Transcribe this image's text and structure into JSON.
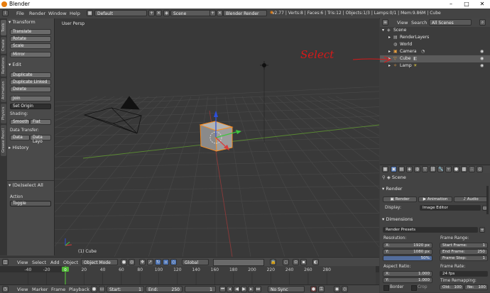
{
  "window": {
    "title": "Blender",
    "controls": [
      "–",
      "□",
      "✕"
    ],
    "accent": "#e87d0d"
  },
  "info_header": {
    "menus": [
      "File",
      "Render",
      "Window",
      "Help"
    ],
    "screen_layout": "Default",
    "scene": "Scene",
    "render_engine": "Blender Render",
    "stats": "v2.77 | Verts:8 | Faces:6 | Tris:12 | Objects:1/3 | Lamps:0/1 | Mem:9.86M | Cube"
  },
  "tool_tabs": [
    "Tools",
    "Create",
    "Relations",
    "Animation",
    "Physics",
    "Grease Pencil"
  ],
  "tool_shelf": {
    "transform_header": "Transform",
    "transform_buttons": [
      "Translate",
      "Rotate",
      "Scale"
    ],
    "mirror": "Mirror",
    "edit_header": "Edit",
    "edit_buttons": [
      "Duplicate",
      "Duplicate Linked",
      "Delete"
    ],
    "join": "Join",
    "set_origin": "Set Origin",
    "shading_label": "Shading:",
    "shading_buttons": [
      "Smooth",
      "Flat"
    ],
    "data_transfer_label": "Data Transfer:",
    "data_transfer_buttons": [
      "Data",
      "Data Layo"
    ],
    "history_header": "History",
    "operator_header": "(De)select All",
    "action_label": "Action",
    "action_value": "Toggle"
  },
  "viewport": {
    "view_label": "User Persp",
    "object_label": "(1) Cube"
  },
  "viewport_header": {
    "menus": [
      "View",
      "Select",
      "Add",
      "Object"
    ],
    "mode": "Object Mode",
    "orientation": "Global"
  },
  "timeline": {
    "ticks": [
      "-40",
      "-20",
      "0",
      "20",
      "40",
      "60",
      "80",
      "100",
      "120",
      "140",
      "160",
      "180",
      "200",
      "220",
      "240",
      "260",
      "280"
    ],
    "current_frame_marker": "0",
    "menus": [
      "View",
      "Marker",
      "Frame",
      "Playback"
    ],
    "start_label": "Start:",
    "start_value": "1",
    "end_label": "End:",
    "end_value": "250",
    "current_value": "1",
    "sync": "No Sync"
  },
  "outliner": {
    "menus": [
      "View",
      "Search"
    ],
    "display": "All Scenes",
    "items": [
      {
        "label": "Scene",
        "indent": 0,
        "icon": "scene-icon"
      },
      {
        "label": "RenderLayers",
        "indent": 1,
        "icon": "renderlayers-icon"
      },
      {
        "label": "World",
        "indent": 1,
        "icon": "world-icon"
      },
      {
        "label": "Camera",
        "indent": 1,
        "icon": "camera-icon"
      },
      {
        "label": "Cube",
        "indent": 1,
        "icon": "mesh-icon",
        "selected": true
      },
      {
        "label": "Lamp",
        "indent": 1,
        "icon": "lamp-icon"
      }
    ]
  },
  "annotation": {
    "text": "Select",
    "color": "#d91818"
  },
  "properties": {
    "breadcrumb": "Scene",
    "render_header": "Render",
    "render_tabs": [
      "Render",
      "Animation",
      "Audio"
    ],
    "display_label": "Display:",
    "display_value": "Image Editor",
    "dimensions_header": "Dimensions",
    "presets": "Render Presets",
    "resolution_label": "Resolution:",
    "res_x": "X:",
    "res_x_value": "1920 px",
    "res_y": "Y:",
    "res_y_value": "1080 px",
    "res_percent": "50%",
    "frame_range_label": "Frame Range:",
    "start_frame": "Start Frame:",
    "start_frame_value": "1",
    "end_frame": "End Frame:",
    "end_frame_value": "250",
    "frame_step": "Frame Step:",
    "frame_step_value": "1",
    "aspect_label": "Aspect Ratio:",
    "asp_x": "X:",
    "asp_x_value": "1.000",
    "asp_y": "Y:",
    "asp_y_value": "1.000",
    "frame_rate_label": "Frame Rate:",
    "frame_rate_value": "24 fps",
    "time_remap_label": "Time Remapping:",
    "old_label": "Old:",
    "old_value": "100",
    "new_label": "Ne:",
    "new_value": "100",
    "border_label": "Border",
    "crop_label": "Crop"
  }
}
